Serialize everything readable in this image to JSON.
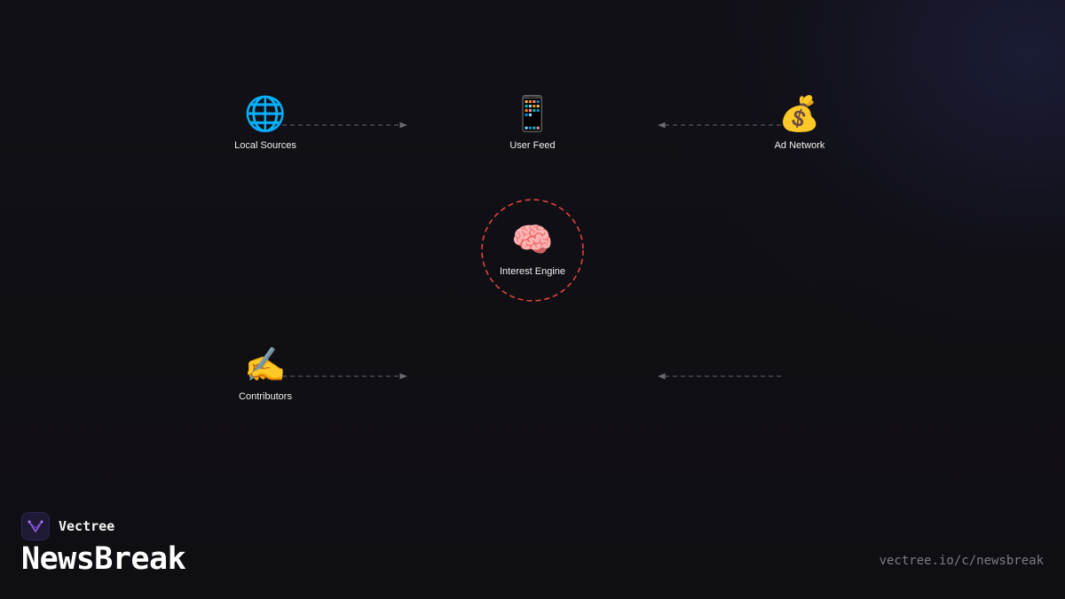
{
  "diagram": {
    "nodes": [
      {
        "id": "local_sources",
        "label": "Local Sources",
        "icon": "globe-icon",
        "glyph": "🌐"
      },
      {
        "id": "user_feed",
        "label": "User Feed",
        "icon": "mobile-phone-icon",
        "glyph": "📱"
      },
      {
        "id": "ad_network",
        "label": "Ad Network",
        "icon": "money-bag-icon",
        "glyph": "💰"
      },
      {
        "id": "interest_engine",
        "label": "Interest Engine",
        "icon": "brain-icon",
        "glyph": "🧠",
        "highlight": true
      },
      {
        "id": "contributors",
        "label": "Contributors",
        "icon": "writing-hand-icon",
        "glyph": "✍️"
      }
    ],
    "edges": [
      {
        "from": "local_sources",
        "to": "user_feed",
        "style": "dashed"
      },
      {
        "from": "ad_network",
        "to": "user_feed",
        "style": "dashed"
      },
      {
        "from": "contributors",
        "to": "interest_engine",
        "style": "dashed"
      },
      {
        "from": "",
        "to": "interest_engine",
        "style": "dashed"
      }
    ],
    "colors": {
      "edge": "#55555e",
      "highlight_ring": "#e0443e",
      "background": "#0f0e13"
    }
  },
  "branding": {
    "brand_name": "Vectree",
    "logo_icon": "vectree-logo-icon",
    "logo_color": "#9b5cf0",
    "company_name": "NewsBreak",
    "url": "vectree.io/c/newsbreak"
  }
}
